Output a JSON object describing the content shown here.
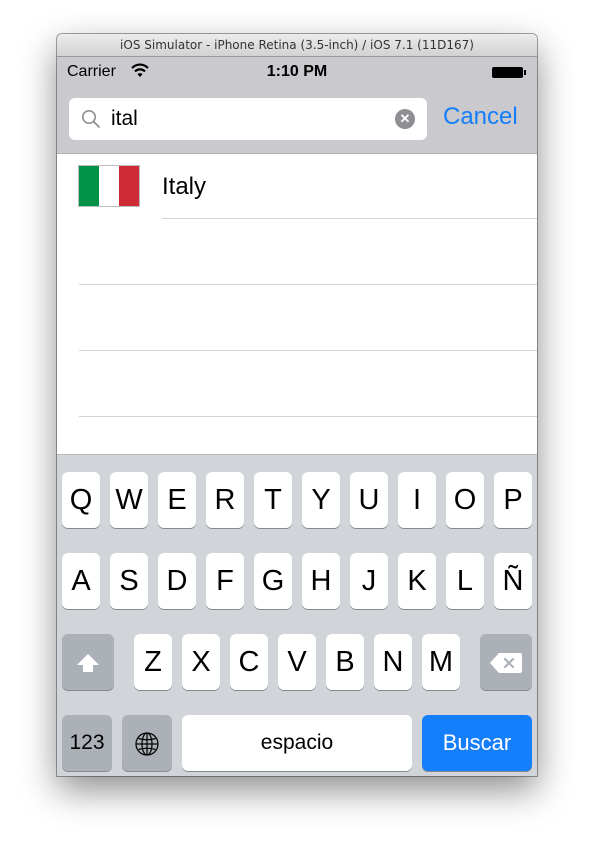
{
  "window": {
    "title": "iOS Simulator - iPhone Retina (3.5-inch) / iOS 7.1 (11D167)"
  },
  "status_bar": {
    "carrier": "Carrier",
    "time": "1:10 PM",
    "wifi_icon": "wifi-icon",
    "battery_icon": "battery-icon"
  },
  "search": {
    "value": "ital",
    "cancel_label": "Cancel",
    "search_icon": "search-icon",
    "clear_icon": "clear-icon",
    "accent_color": "#147efb"
  },
  "results": [
    {
      "label": "Italy",
      "flag_colors": [
        "#009246",
        "#ffffff",
        "#ce2b37"
      ]
    }
  ],
  "keyboard": {
    "row1": [
      "Q",
      "W",
      "E",
      "R",
      "T",
      "Y",
      "U",
      "I",
      "O",
      "P"
    ],
    "row2": [
      "A",
      "S",
      "D",
      "F",
      "G",
      "H",
      "J",
      "K",
      "L",
      "Ñ"
    ],
    "row3": [
      "Z",
      "X",
      "C",
      "V",
      "B",
      "N",
      "M"
    ],
    "numbers_label": "123",
    "space_label": "espacio",
    "search_label": "Buscar",
    "shift_icon": "shift-icon",
    "delete_icon": "delete-icon",
    "globe_icon": "globe-icon"
  }
}
